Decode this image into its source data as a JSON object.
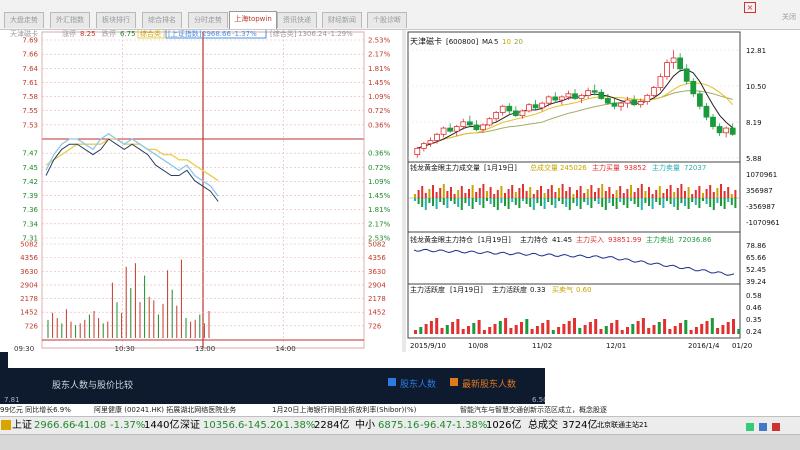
{
  "tabs": [
    "大盘走势",
    "外汇指数",
    "板块排行",
    "综合排名",
    "分时走势",
    "个股资料",
    "上海topwin",
    "资讯快递",
    "财经新闻",
    "个股诊断"
  ],
  "top_right_label": "关闭",
  "close_glyph": "×",
  "left_chart": {
    "legend": {
      "name": "天津磁卡",
      "name_color": "#4a90e2",
      "price_label": "涨停",
      "price": "8.25",
      "low_label": "跌停",
      "low": "6.75",
      "composite": "综合类",
      "index_label": "上证指数",
      "index_value": "2968.66",
      "index_change": "-1.37%",
      "sector_label": "综合类",
      "sector_value": "1306.24",
      "sector_change": "-1.29%"
    },
    "price_ticks_left": [
      "7.69",
      "7.66",
      "7.64",
      "7.61",
      "7.58",
      "7.55",
      "7.53",
      "",
      "7.47",
      "7.45",
      "7.42",
      "7.39",
      "7.36",
      "7.34",
      "7.31"
    ],
    "pct_ticks_right": [
      "2.53%",
      "2.17%",
      "1.81%",
      "1.45%",
      "1.09%",
      "0.72%",
      "0.36%",
      "",
      "0.36%",
      "0.72%",
      "1.09%",
      "1.45%",
      "1.81%",
      "2.17%",
      "2.53%"
    ],
    "vol_ticks": [
      "5082",
      "4356",
      "3630",
      "2904",
      "2178",
      "1452",
      "726"
    ],
    "time_ticks": [
      "09:30",
      "10:30",
      "13:00",
      "14:00"
    ],
    "price_series": [
      7.44,
      7.47,
      7.49,
      7.5,
      7.5,
      7.49,
      7.48,
      7.5,
      7.51,
      7.5,
      7.49,
      7.5,
      7.49,
      7.48,
      7.47,
      7.46,
      7.45,
      7.44,
      7.45,
      7.43,
      7.42,
      7.41,
      7.39
    ],
    "avg_series": [
      7.45,
      7.46,
      7.47,
      7.48,
      7.49,
      7.49,
      7.49,
      7.49,
      7.5,
      7.5,
      7.49,
      7.49,
      7.49,
      7.48,
      7.48,
      7.47,
      7.47,
      7.46,
      7.46,
      7.45,
      7.44,
      7.43,
      7.42
    ],
    "index_series": [
      7.43,
      7.46,
      7.48,
      7.49,
      7.49,
      7.48,
      7.47,
      7.48,
      7.5,
      7.49,
      7.48,
      7.49,
      7.48,
      7.47,
      7.45,
      7.44,
      7.43,
      7.43,
      7.44,
      7.42,
      7.41,
      7.4,
      7.38
    ],
    "volume_series": [
      800,
      1200,
      900,
      600,
      1400,
      700,
      500,
      600,
      800,
      1100,
      1300,
      900,
      600,
      700,
      2900,
      1800,
      1200,
      3800,
      2600,
      4000,
      1800,
      3300,
      2100,
      1900,
      1100,
      1700,
      3600,
      2500,
      1600,
      4200,
      900,
      700,
      800,
      1100,
      600,
      1300
    ]
  },
  "right_chart": {
    "title": "天津磁卡",
    "code": "[600800]",
    "ma_label": "MA",
    "ma_values": [
      "5",
      "10",
      "20"
    ],
    "price_ticks": [
      "12.81",
      "10.50",
      "8.19",
      "5.88"
    ],
    "candles": [
      [
        6.1,
        6.6,
        5.9,
        6.5
      ],
      [
        6.5,
        6.9,
        6.3,
        6.8
      ],
      [
        6.8,
        7.2,
        6.6,
        7.0
      ],
      [
        7.0,
        7.5,
        6.8,
        7.4
      ],
      [
        7.4,
        7.9,
        7.2,
        7.8
      ],
      [
        7.8,
        8.1,
        7.5,
        7.6
      ],
      [
        7.6,
        8.0,
        7.3,
        7.9
      ],
      [
        7.9,
        8.4,
        7.7,
        8.2
      ],
      [
        8.2,
        8.6,
        7.9,
        8.0
      ],
      [
        8.0,
        8.3,
        7.6,
        7.7
      ],
      [
        7.7,
        8.1,
        7.5,
        8.0
      ],
      [
        8.0,
        8.5,
        7.9,
        8.4
      ],
      [
        8.4,
        8.9,
        8.2,
        8.8
      ],
      [
        8.8,
        9.3,
        8.6,
        9.2
      ],
      [
        9.2,
        9.4,
        8.7,
        8.9
      ],
      [
        8.9,
        9.2,
        8.5,
        8.6
      ],
      [
        8.6,
        9.0,
        8.4,
        8.9
      ],
      [
        8.9,
        9.4,
        8.8,
        9.3
      ],
      [
        9.3,
        9.6,
        9.0,
        9.1
      ],
      [
        9.1,
        9.5,
        8.9,
        9.4
      ],
      [
        9.4,
        9.9,
        9.2,
        9.8
      ],
      [
        9.8,
        10.1,
        9.4,
        9.6
      ],
      [
        9.6,
        9.9,
        9.3,
        9.8
      ],
      [
        9.8,
        10.2,
        9.6,
        10.0
      ],
      [
        10.0,
        10.3,
        9.6,
        9.7
      ],
      [
        9.7,
        10.0,
        9.4,
        9.9
      ],
      [
        9.9,
        10.4,
        9.7,
        10.2
      ],
      [
        10.2,
        10.6,
        9.9,
        10.1
      ],
      [
        10.1,
        10.3,
        9.6,
        9.7
      ],
      [
        9.7,
        10.0,
        9.3,
        9.4
      ],
      [
        9.4,
        9.7,
        9.0,
        9.2
      ],
      [
        9.2,
        9.5,
        8.9,
        9.4
      ],
      [
        9.4,
        9.8,
        9.1,
        9.6
      ],
      [
        9.6,
        9.9,
        9.2,
        9.3
      ],
      [
        9.3,
        9.7,
        9.1,
        9.5
      ],
      [
        9.5,
        10.0,
        9.3,
        9.9
      ],
      [
        9.9,
        10.5,
        9.7,
        10.4
      ],
      [
        10.4,
        11.3,
        10.2,
        11.1
      ],
      [
        11.1,
        12.2,
        10.9,
        12.0
      ],
      [
        12.0,
        12.8,
        11.6,
        12.3
      ],
      [
        12.3,
        12.6,
        11.4,
        11.6
      ],
      [
        11.6,
        11.9,
        10.6,
        10.8
      ],
      [
        10.8,
        11.0,
        9.8,
        10.0
      ],
      [
        10.0,
        10.2,
        9.0,
        9.2
      ],
      [
        9.2,
        9.4,
        8.3,
        8.5
      ],
      [
        8.5,
        8.7,
        7.7,
        7.9
      ],
      [
        7.9,
        8.1,
        7.3,
        7.5
      ],
      [
        7.5,
        7.9,
        7.2,
        7.8
      ],
      [
        7.8,
        8.1,
        7.3,
        7.4
      ]
    ],
    "sub1": {
      "title": "钱龙黄金眼主力成交量",
      "period": "[1月19日]",
      "total_label": "总成交量",
      "total": "245026",
      "buy_label": "主力买量",
      "buy": "93852",
      "sell_label": "主力卖量",
      "sell": "72037",
      "ticks": [
        "1070961",
        "356987",
        "-356987",
        "-1070961"
      ]
    },
    "sub2": {
      "title": "钱龙黄金眼主力持仓",
      "period": "[1月19日]",
      "hold_label": "主力持仓",
      "hold": "41.45",
      "in_label": "主力买入",
      "in": "93851.99",
      "out_label": "主力卖出",
      "out": "72036.86",
      "ticks": [
        "78.86",
        "65.66",
        "52.45",
        "39.24"
      ]
    },
    "sub3": {
      "title": "主力活跃度",
      "period": "[1月19日]",
      "act_label": "主力活跃度",
      "act": "0.33",
      "mood_label": "买卖气",
      "mood": "0.60",
      "ticks": [
        "0.58",
        "0.46",
        "0.35",
        "0.24"
      ]
    },
    "date_ticks": [
      "2015/9/10",
      "10/08",
      "11/02",
      "12/01",
      "2016/1/4",
      "01/20"
    ]
  },
  "info_panel": {
    "title": "股东人数与股价比较",
    "legend_a": "股东人数",
    "legend_b": "最新股东人数",
    "left_val": "7.81",
    "right_val": "6.50"
  },
  "ticker": {
    "items": [
      "99亿元 同比增长6.9%",
      "阿里健康 (00241.HK) 拓展湖北网络医院业务",
      "1月20日上海银行间同业拆放利率(Shibor)(%)",
      "智能汽车与智慧交通创新示范区成立，概念股逐"
    ]
  },
  "statusbar": {
    "sh_label": "上证",
    "sh_value": "2966.66",
    "sh_change": "-41.08",
    "sh_pct": "-1.37%",
    "sh_amount": "1440亿",
    "sz_label": "深证",
    "sz_value": "10356.6",
    "sz_change": "-145.20",
    "sz_pct": "-1.38%",
    "sz_amount": "2284亿",
    "zx_label": "中小",
    "zx_value": "6875.16",
    "zx_change": "-96.47",
    "zx_pct": "-1.38%",
    "zx_amount": "1026亿",
    "total_label": "总成交",
    "total_value": "3724亿",
    "site": "北京联通主站21"
  }
}
